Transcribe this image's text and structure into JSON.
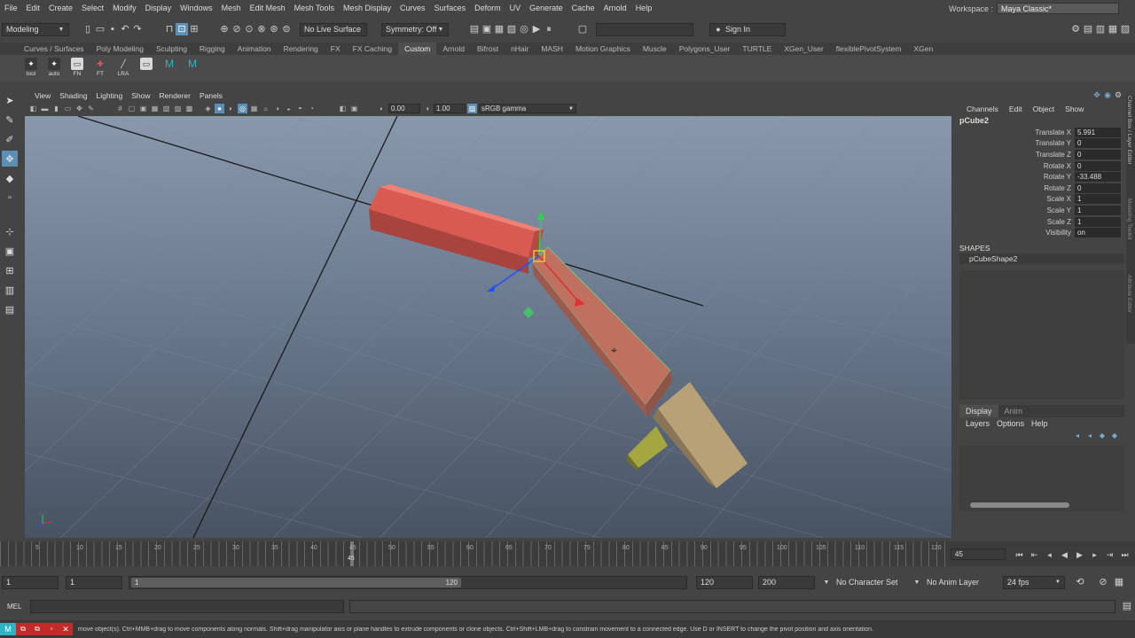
{
  "menubar": {
    "items": [
      "File",
      "Edit",
      "Create",
      "Select",
      "Modify",
      "Display",
      "Windows",
      "Mesh",
      "Edit Mesh",
      "Mesh Tools",
      "Mesh Display",
      "Curves",
      "Surfaces",
      "Deform",
      "UV",
      "Generate",
      "Cache",
      "Arnold",
      "Help"
    ],
    "workspace_label": "Workspace :",
    "workspace_value": "Maya Classic*"
  },
  "statusline": {
    "mode": "Modeling",
    "live_surface": "No Live Surface",
    "symmetry": "Symmetry: Off",
    "sign_in": "Sign In"
  },
  "shelf_tabs": [
    "Curves / Surfaces",
    "Poly Modeling",
    "Sculpting",
    "Rigging",
    "Animation",
    "Rendering",
    "FX",
    "FX Caching",
    "Custom",
    "Arnold",
    "Bifrost",
    "nHair",
    "MASH",
    "Motion Graphics",
    "Muscle",
    "Polygons_User",
    "TURTLE",
    "XGen_User",
    "flexiblePivotSystem",
    "XGen"
  ],
  "shelf_active": "Custom",
  "shelf_buttons": [
    "tool",
    "auto",
    "FN",
    "FT",
    "LRA",
    "",
    ""
  ],
  "panel": {
    "menu": [
      "View",
      "Shading",
      "Lighting",
      "Show",
      "Renderer",
      "Panels"
    ],
    "field_a": "0.00",
    "field_b": "1.00",
    "colorspace": "sRGB gamma"
  },
  "channel_box": {
    "menu": [
      "Channels",
      "Edit",
      "Object",
      "Show"
    ],
    "object": "pCube2",
    "attrs": [
      {
        "name": "Translate X",
        "value": "5.991"
      },
      {
        "name": "Translate Y",
        "value": "0"
      },
      {
        "name": "Translate Z",
        "value": "0"
      },
      {
        "name": "Rotate X",
        "value": "0"
      },
      {
        "name": "Rotate Y",
        "value": "-33.488"
      },
      {
        "name": "Rotate Z",
        "value": "0"
      },
      {
        "name": "Scale X",
        "value": "1"
      },
      {
        "name": "Scale Y",
        "value": "1"
      },
      {
        "name": "Scale Z",
        "value": "1"
      },
      {
        "name": "Visibility",
        "value": "on"
      }
    ],
    "shapes_label": "SHAPES",
    "shape": "pCubeShape2"
  },
  "layer_editor": {
    "tabs": [
      "Display",
      "Anim"
    ],
    "menu": [
      "Layers",
      "Options",
      "Help"
    ]
  },
  "side_tabs": [
    "Channel Box / Layer Editor",
    "Modeling Toolkit",
    "Attribute Editor"
  ],
  "timeline": {
    "ticks": [
      "5",
      "10",
      "15",
      "20",
      "25",
      "30",
      "35",
      "40",
      "45",
      "50",
      "55",
      "60",
      "65",
      "70",
      "75",
      "80",
      "85",
      "90",
      "95",
      "100",
      "105",
      "110",
      "115",
      "120"
    ],
    "current_frame": "45",
    "playhead_label": "45"
  },
  "range": {
    "start": "1",
    "inner_start": "1",
    "slider_start": "1",
    "slider_end": "120",
    "end": "120",
    "outer_end": "200",
    "character_set": "No Character Set",
    "anim_layer": "No Anim Layer",
    "fps": "24 fps"
  },
  "command": {
    "label": "MEL"
  },
  "help": {
    "text": "move object(s). Ctrl+MMB+drag to move components along normals. Shift+drag manipulator axis or plane handles to extrude components or clone objects. Ctrl+Shift+LMB+drag to constrain movement to a connected edge. Use D or INSERT to change the pivot position and axis orientation."
  },
  "colors": {
    "selected_red": "#e8645a",
    "selected_highlight": "#c96b62",
    "object_tan": "#b8a077",
    "object_olive": "#a4a640",
    "accent_blue": "#5b8fb4"
  }
}
